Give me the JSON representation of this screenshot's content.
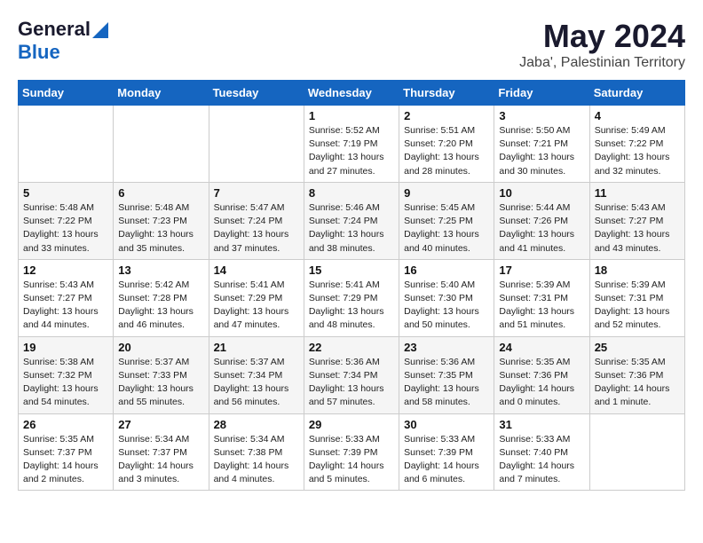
{
  "logo": {
    "general": "General",
    "blue": "Blue"
  },
  "title": "May 2024",
  "location": "Jaba', Palestinian Territory",
  "days_of_week": [
    "Sunday",
    "Monday",
    "Tuesday",
    "Wednesday",
    "Thursday",
    "Friday",
    "Saturday"
  ],
  "weeks": [
    [
      {
        "day": "",
        "info": ""
      },
      {
        "day": "",
        "info": ""
      },
      {
        "day": "",
        "info": ""
      },
      {
        "day": "1",
        "info": "Sunrise: 5:52 AM\nSunset: 7:19 PM\nDaylight: 13 hours and 27 minutes."
      },
      {
        "day": "2",
        "info": "Sunrise: 5:51 AM\nSunset: 7:20 PM\nDaylight: 13 hours and 28 minutes."
      },
      {
        "day": "3",
        "info": "Sunrise: 5:50 AM\nSunset: 7:21 PM\nDaylight: 13 hours and 30 minutes."
      },
      {
        "day": "4",
        "info": "Sunrise: 5:49 AM\nSunset: 7:22 PM\nDaylight: 13 hours and 32 minutes."
      }
    ],
    [
      {
        "day": "5",
        "info": "Sunrise: 5:48 AM\nSunset: 7:22 PM\nDaylight: 13 hours and 33 minutes."
      },
      {
        "day": "6",
        "info": "Sunrise: 5:48 AM\nSunset: 7:23 PM\nDaylight: 13 hours and 35 minutes."
      },
      {
        "day": "7",
        "info": "Sunrise: 5:47 AM\nSunset: 7:24 PM\nDaylight: 13 hours and 37 minutes."
      },
      {
        "day": "8",
        "info": "Sunrise: 5:46 AM\nSunset: 7:24 PM\nDaylight: 13 hours and 38 minutes."
      },
      {
        "day": "9",
        "info": "Sunrise: 5:45 AM\nSunset: 7:25 PM\nDaylight: 13 hours and 40 minutes."
      },
      {
        "day": "10",
        "info": "Sunrise: 5:44 AM\nSunset: 7:26 PM\nDaylight: 13 hours and 41 minutes."
      },
      {
        "day": "11",
        "info": "Sunrise: 5:43 AM\nSunset: 7:27 PM\nDaylight: 13 hours and 43 minutes."
      }
    ],
    [
      {
        "day": "12",
        "info": "Sunrise: 5:43 AM\nSunset: 7:27 PM\nDaylight: 13 hours and 44 minutes."
      },
      {
        "day": "13",
        "info": "Sunrise: 5:42 AM\nSunset: 7:28 PM\nDaylight: 13 hours and 46 minutes."
      },
      {
        "day": "14",
        "info": "Sunrise: 5:41 AM\nSunset: 7:29 PM\nDaylight: 13 hours and 47 minutes."
      },
      {
        "day": "15",
        "info": "Sunrise: 5:41 AM\nSunset: 7:29 PM\nDaylight: 13 hours and 48 minutes."
      },
      {
        "day": "16",
        "info": "Sunrise: 5:40 AM\nSunset: 7:30 PM\nDaylight: 13 hours and 50 minutes."
      },
      {
        "day": "17",
        "info": "Sunrise: 5:39 AM\nSunset: 7:31 PM\nDaylight: 13 hours and 51 minutes."
      },
      {
        "day": "18",
        "info": "Sunrise: 5:39 AM\nSunset: 7:31 PM\nDaylight: 13 hours and 52 minutes."
      }
    ],
    [
      {
        "day": "19",
        "info": "Sunrise: 5:38 AM\nSunset: 7:32 PM\nDaylight: 13 hours and 54 minutes."
      },
      {
        "day": "20",
        "info": "Sunrise: 5:37 AM\nSunset: 7:33 PM\nDaylight: 13 hours and 55 minutes."
      },
      {
        "day": "21",
        "info": "Sunrise: 5:37 AM\nSunset: 7:34 PM\nDaylight: 13 hours and 56 minutes."
      },
      {
        "day": "22",
        "info": "Sunrise: 5:36 AM\nSunset: 7:34 PM\nDaylight: 13 hours and 57 minutes."
      },
      {
        "day": "23",
        "info": "Sunrise: 5:36 AM\nSunset: 7:35 PM\nDaylight: 13 hours and 58 minutes."
      },
      {
        "day": "24",
        "info": "Sunrise: 5:35 AM\nSunset: 7:36 PM\nDaylight: 14 hours and 0 minutes."
      },
      {
        "day": "25",
        "info": "Sunrise: 5:35 AM\nSunset: 7:36 PM\nDaylight: 14 hours and 1 minute."
      }
    ],
    [
      {
        "day": "26",
        "info": "Sunrise: 5:35 AM\nSunset: 7:37 PM\nDaylight: 14 hours and 2 minutes."
      },
      {
        "day": "27",
        "info": "Sunrise: 5:34 AM\nSunset: 7:37 PM\nDaylight: 14 hours and 3 minutes."
      },
      {
        "day": "28",
        "info": "Sunrise: 5:34 AM\nSunset: 7:38 PM\nDaylight: 14 hours and 4 minutes."
      },
      {
        "day": "29",
        "info": "Sunrise: 5:33 AM\nSunset: 7:39 PM\nDaylight: 14 hours and 5 minutes."
      },
      {
        "day": "30",
        "info": "Sunrise: 5:33 AM\nSunset: 7:39 PM\nDaylight: 14 hours and 6 minutes."
      },
      {
        "day": "31",
        "info": "Sunrise: 5:33 AM\nSunset: 7:40 PM\nDaylight: 14 hours and 7 minutes."
      },
      {
        "day": "",
        "info": ""
      }
    ]
  ]
}
